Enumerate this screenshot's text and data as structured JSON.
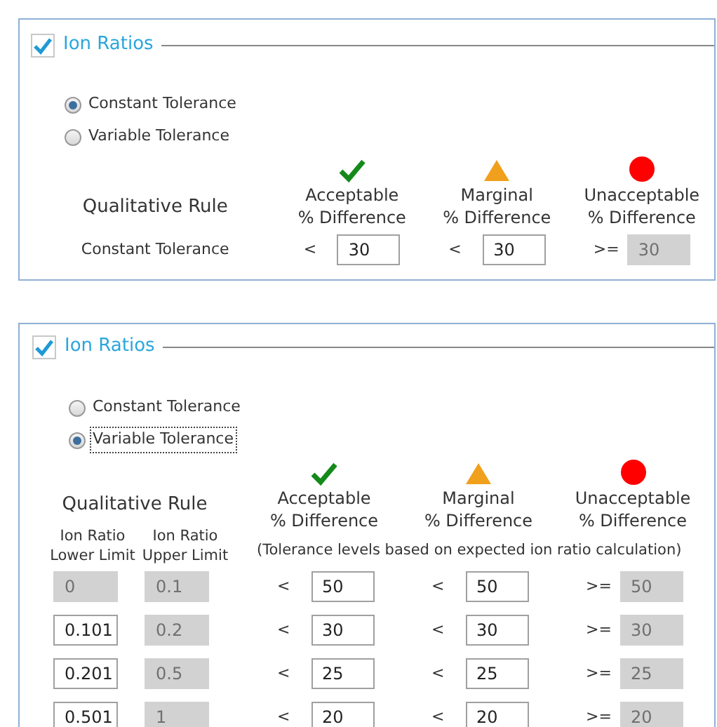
{
  "panels": [
    {
      "kind": "constant",
      "title": "Ion Ratios",
      "checked": true,
      "modes": [
        {
          "label": "Constant Tolerance",
          "selected": true,
          "focused": false
        },
        {
          "label": "Variable Tolerance",
          "selected": false,
          "focused": false
        }
      ],
      "rule_label": "Qualitative Rule",
      "categories": [
        {
          "kind": "acceptable",
          "label": "Acceptable",
          "sublabel": "% Difference"
        },
        {
          "kind": "marginal",
          "label": "Marginal",
          "sublabel": "% Difference"
        },
        {
          "kind": "unacceptable",
          "label": "Unacceptable",
          "sublabel": "% Difference"
        }
      ],
      "rows": [
        {
          "label": "Constant Tolerance",
          "cells": [
            {
              "op": "<",
              "value": "30",
              "disabled": false
            },
            {
              "op": "<",
              "value": "30",
              "disabled": false
            },
            {
              "op": ">=",
              "value": "30",
              "disabled": true
            }
          ]
        }
      ]
    },
    {
      "kind": "variable",
      "title": "Ion Ratios",
      "checked": true,
      "modes": [
        {
          "label": "Constant Tolerance",
          "selected": false,
          "focused": false
        },
        {
          "label": "Variable Tolerance",
          "selected": true,
          "focused": true
        }
      ],
      "rule_label": "Qualitative Rule",
      "categories": [
        {
          "kind": "acceptable",
          "label": "Acceptable",
          "sublabel": "% Difference"
        },
        {
          "kind": "marginal",
          "label": "Marginal",
          "sublabel": "% Difference"
        },
        {
          "kind": "unacceptable",
          "label": "Unacceptable",
          "sublabel": "% Difference"
        }
      ],
      "limit_headers": [
        "Ion Ratio Lower Limit",
        "Ion Ratio Upper Limit"
      ],
      "note": "(Tolerance levels based on expected ion ratio calculation)",
      "rows": [
        {
          "lower": {
            "value": "0",
            "disabled": true
          },
          "upper": {
            "value": "0.1",
            "disabled": true
          },
          "cells": [
            {
              "op": "<",
              "value": "50",
              "disabled": false
            },
            {
              "op": "<",
              "value": "50",
              "disabled": false
            },
            {
              "op": ">=",
              "value": "50",
              "disabled": true
            }
          ]
        },
        {
          "lower": {
            "value": "0.101",
            "disabled": false
          },
          "upper": {
            "value": "0.2",
            "disabled": true
          },
          "cells": [
            {
              "op": "<",
              "value": "30",
              "disabled": false
            },
            {
              "op": "<",
              "value": "30",
              "disabled": false
            },
            {
              "op": ">=",
              "value": "30",
              "disabled": true
            }
          ]
        },
        {
          "lower": {
            "value": "0.201",
            "disabled": false
          },
          "upper": {
            "value": "0.5",
            "disabled": true
          },
          "cells": [
            {
              "op": "<",
              "value": "25",
              "disabled": false
            },
            {
              "op": "<",
              "value": "25",
              "disabled": false
            },
            {
              "op": ">=",
              "value": "25",
              "disabled": true
            }
          ]
        },
        {
          "lower": {
            "value": "0.501",
            "disabled": false
          },
          "upper": {
            "value": "1",
            "disabled": true
          },
          "cells": [
            {
              "op": "<",
              "value": "20",
              "disabled": false
            },
            {
              "op": "<",
              "value": "20",
              "disabled": false
            },
            {
              "op": ">=",
              "value": "20",
              "disabled": true
            }
          ]
        }
      ]
    }
  ]
}
